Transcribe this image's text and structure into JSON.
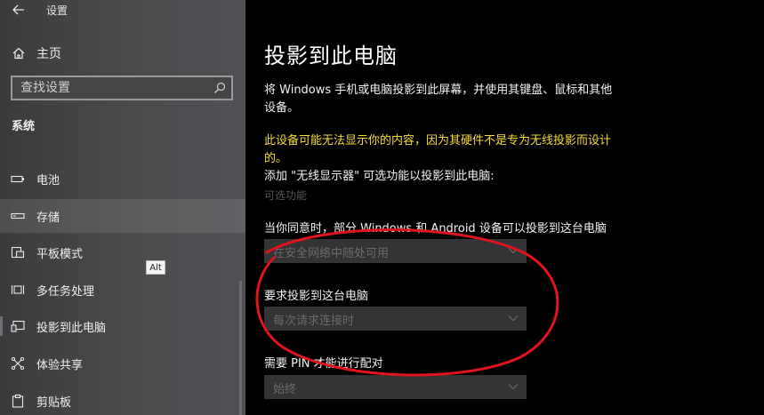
{
  "window": {
    "title": "设置"
  },
  "sidebar": {
    "home_label": "主页",
    "search_placeholder": "查找设置",
    "section": "系统",
    "items": [
      {
        "label": "电池",
        "icon": "battery-icon"
      },
      {
        "label": "存储",
        "icon": "storage-icon"
      },
      {
        "label": "平板模式",
        "icon": "tablet-mode-icon"
      },
      {
        "label": "多任务处理",
        "icon": "multitasking-icon"
      },
      {
        "label": "投影到此电脑",
        "icon": "project-icon"
      },
      {
        "label": "体验共享",
        "icon": "shared-experiences-icon"
      },
      {
        "label": "剪贴板",
        "icon": "clipboard-icon"
      }
    ],
    "tooltip": "Alt"
  },
  "main": {
    "title": "投影到此电脑",
    "description": "将 Windows 手机或电脑投影到此屏幕，并使用其键盘、鼠标和其他设备。",
    "warning": "此设备可能无法显示你的内容，因为其硬件不是专为无线投影而设计的。",
    "add_text": "添加 \"无线显示器\" 可选功能以投影到此电脑:",
    "optional_link": "可选功能",
    "settings": [
      {
        "label": "当你同意时，部分 Windows 和 Android 设备可以投影到这台电脑",
        "value": "在安全网络中随处可用"
      },
      {
        "label": "要求投影到这台电脑",
        "value": "每次请求连接时"
      },
      {
        "label": "需要 PIN 才能进行配对",
        "value": "始终"
      }
    ]
  },
  "colors": {
    "background": "#000000",
    "warning": "#f5dd3b",
    "annotation": "#e0141e"
  }
}
